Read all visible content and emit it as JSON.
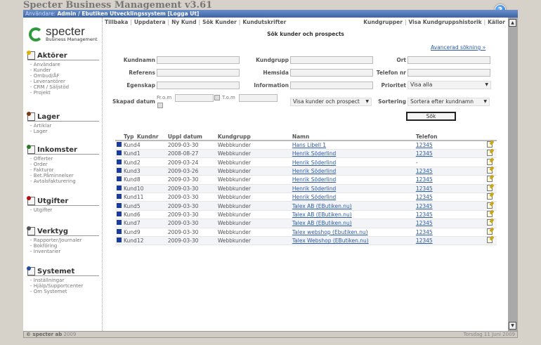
{
  "app_title": "Specter Business Management v3.61",
  "userbar": {
    "prefix": "Användare:",
    "user": "Admin / Ebutiken Utvecklingssystem [Logga Ut]"
  },
  "help_icon": "?",
  "logo": {
    "name": "specter",
    "tagline": "Business Management"
  },
  "sidebar": [
    {
      "title": "Aktörer",
      "color": "#e0b000",
      "items": [
        "Användare",
        "Kunder",
        "Ombud/ÅF",
        "Leverantörer",
        "CRM / Säljstöd",
        "Projekt"
      ]
    },
    {
      "title": "Lager",
      "color": "#7a3a10",
      "items": [
        "Artiklar",
        "Lager"
      ]
    },
    {
      "title": "Inkomster",
      "color": "#2a7a2a",
      "items": [
        "Offerter",
        "Order",
        "Fakturor",
        "Bet.Påminnelser",
        "Avtalsfakturering"
      ]
    },
    {
      "title": "Utgifter",
      "color": "#b01010",
      "items": [
        "Utgifter"
      ]
    },
    {
      "title": "Verktyg",
      "color": "#555555",
      "items": [
        "Rapporter/Journaler",
        "Bokföring",
        "Inventarier"
      ]
    },
    {
      "title": "Systemet",
      "color": "#2a4aa0",
      "items": [
        "Inställningar",
        "Hjälp/Supportcenter",
        "Om Systemet"
      ]
    }
  ],
  "nav_left": [
    "Tillbaka",
    "Uppdatera",
    "Ny Kund",
    "Sök Kunder",
    "Kundutskrifter"
  ],
  "nav_right": [
    "Kundgrupper",
    "Visa Kundgruppshistorik",
    "Källor"
  ],
  "page_title": "Sök kunder och prospects",
  "advanced_link": "Avancerad sökning »",
  "form": {
    "kundnamn": "Kundnamn",
    "kundgrupp": "Kundgrupp",
    "ort": "Ort",
    "referens": "Referens",
    "hemsida": "Hemsida",
    "telefon": "Telefon nr",
    "egenskap": "Egenskap",
    "information": "Information",
    "prioritet": "Prioritet",
    "prioritet_value": "Visa alla",
    "skapad": "Skapad datum",
    "from": "Fr.o.m",
    "tom": "T.o.m",
    "visa_value": "Visa kunder och prospect",
    "sortering": "Sortering",
    "sortering_value": "Sortera efter kundnamn",
    "search_button": "Sök"
  },
  "table": {
    "headers": [
      "Typ",
      "Kundnr",
      "Uppl datum",
      "Kundgrupp",
      "Namn",
      "Telefon"
    ],
    "rows": [
      [
        "Kund",
        "4",
        "2009-03-30",
        "Webbkunder",
        "Hans Libell 1",
        "12345"
      ],
      [
        "Kund",
        "1",
        "2008-08-27",
        "Webbkunder",
        "Henrik Söderlind",
        "12345"
      ],
      [
        "Kund",
        "2",
        "2009-03-24",
        "Webbkunder",
        "Henrik Söderlind",
        "-"
      ],
      [
        "Kund",
        "3",
        "2009-03-26",
        "Webbkunder",
        "Henrik Söderlind",
        "12345"
      ],
      [
        "Kund",
        "8",
        "2009-03-30",
        "Webbkunder",
        "Henrik Söderlind",
        "12345"
      ],
      [
        "Kund",
        "10",
        "2009-03-30",
        "Webbkunder",
        "Henrik Söderlind",
        "12345"
      ],
      [
        "Kund",
        "11",
        "2009-03-30",
        "Webbkunder",
        "Henrik Söderlind",
        "12345"
      ],
      [
        "Kund",
        "5",
        "2009-03-30",
        "Webbkunder",
        "Talex AB (EButiken.nu)",
        "12345"
      ],
      [
        "Kund",
        "6",
        "2009-03-30",
        "Webbkunder",
        "Talex AB (EButiken.nu)",
        "12345"
      ],
      [
        "Kund",
        "7",
        "2009-03-30",
        "Webbkunder",
        "Talex AB (EButiken.nu)",
        "12345"
      ],
      [
        "Kund",
        "9",
        "2009-03-30",
        "Webbkunder",
        "Talex webshop (Ebutiken.nu)",
        "12345"
      ],
      [
        "Kund",
        "12",
        "2009-03-30",
        "Webbkunder",
        "Talex Webshop (EButiken.nu)",
        "12345"
      ]
    ]
  },
  "footer": {
    "company": "© specter ab",
    "year": "2009",
    "date": "Torsdag 11 Juni 2009"
  }
}
